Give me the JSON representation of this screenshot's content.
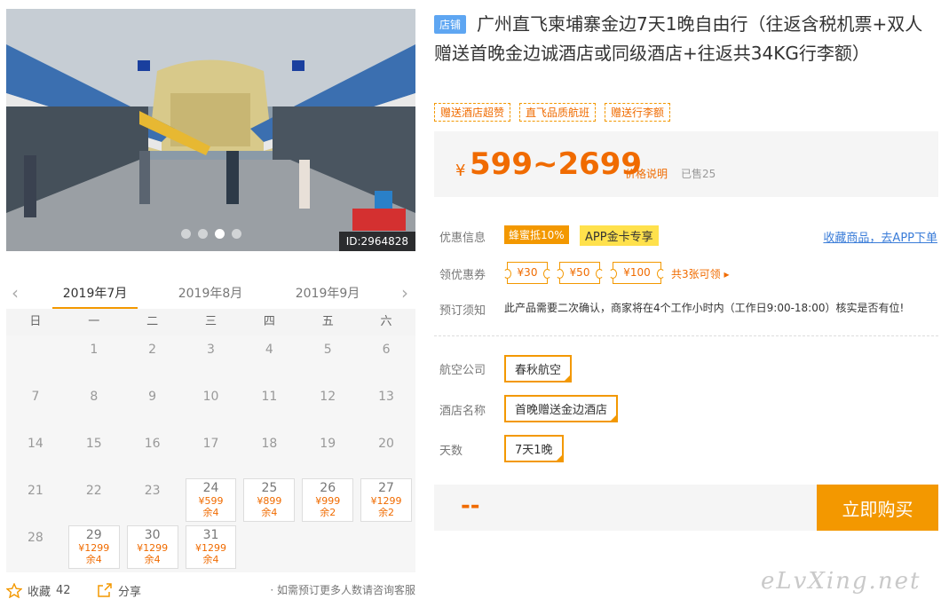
{
  "photo": {
    "id_label": "ID:2964828",
    "dots": [
      false,
      false,
      true,
      false
    ],
    "icon": "market-street-photo"
  },
  "calendar": {
    "prev_icon": "chevron-left-icon",
    "next_icon": "chevron-right-icon",
    "months": [
      "2019年7月",
      "2019年8月",
      "2019年9月"
    ],
    "active_month": 0,
    "weekdays": [
      "日",
      "一",
      "二",
      "三",
      "四",
      "五",
      "六"
    ],
    "cells": [
      {
        "d": ""
      },
      {
        "d": "1"
      },
      {
        "d": "2"
      },
      {
        "d": "3"
      },
      {
        "d": "4"
      },
      {
        "d": "5"
      },
      {
        "d": "6"
      },
      {
        "d": "7"
      },
      {
        "d": "8"
      },
      {
        "d": "9"
      },
      {
        "d": "10"
      },
      {
        "d": "11"
      },
      {
        "d": "12"
      },
      {
        "d": "13"
      },
      {
        "d": "14"
      },
      {
        "d": "15"
      },
      {
        "d": "16"
      },
      {
        "d": "17"
      },
      {
        "d": "18"
      },
      {
        "d": "19"
      },
      {
        "d": "20"
      },
      {
        "d": "21"
      },
      {
        "d": "22"
      },
      {
        "d": "23"
      },
      {
        "d": "24",
        "price": "¥599",
        "stock": "余4"
      },
      {
        "d": "25",
        "price": "¥899",
        "stock": "余4"
      },
      {
        "d": "26",
        "price": "¥999",
        "stock": "余2"
      },
      {
        "d": "27",
        "price": "¥1299",
        "stock": "余2"
      },
      {
        "d": "28"
      },
      {
        "d": "29",
        "price": "¥1299",
        "stock": "余4"
      },
      {
        "d": "30",
        "price": "¥1299",
        "stock": "余4"
      },
      {
        "d": "31",
        "price": "¥1299",
        "stock": "余4"
      },
      {
        "d": ""
      },
      {
        "d": ""
      },
      {
        "d": ""
      }
    ]
  },
  "left_footer": {
    "fav_label": "收藏",
    "fav_count": "42",
    "share_label": "分享",
    "note": "· 如需预订更多人数请咨询客服"
  },
  "product": {
    "badge": "店铺",
    "title": "广州直飞柬埔寨金边7天1晚自由行（往返含税机票+双人赠送首晚金边诚酒店或同级酒店+往返共34KG行李额）",
    "tags": [
      "赠送酒店超赞",
      "直飞品质航班",
      "赠送行李额"
    ],
    "currency": "¥",
    "price_range": "599~2699",
    "price_explain": "价格说明",
    "sold": "已售25"
  },
  "promo": {
    "label": "优惠信息",
    "tag_a": "蜂蜜抵10%",
    "tag_b": "APP金卡专享",
    "fav_link": "收藏商品，去APP下单"
  },
  "coupons": {
    "label": "领优惠券",
    "items": [
      "¥30",
      "¥50",
      "¥100"
    ],
    "more": "共3张可领 ▸"
  },
  "notice": {
    "label": "预订须知",
    "text": "此产品需要二次确认，商家将在4个工作小时内（工作日9:00-18:00）核实是否有位!"
  },
  "options": {
    "airline_label": "航空公司",
    "airline": "春秋航空",
    "hotel_label": "酒店名称",
    "hotel": "首晚赠送金边酒店",
    "days_label": "天数",
    "days": "7天1晚"
  },
  "buy": {
    "total": "--",
    "button": "立即购买"
  },
  "watermark": "eLvXing.net",
  "colors": {
    "accent": "#f39800",
    "price": "#f06b00",
    "link": "#3a7cd8",
    "badge": "#5ea6f2"
  }
}
